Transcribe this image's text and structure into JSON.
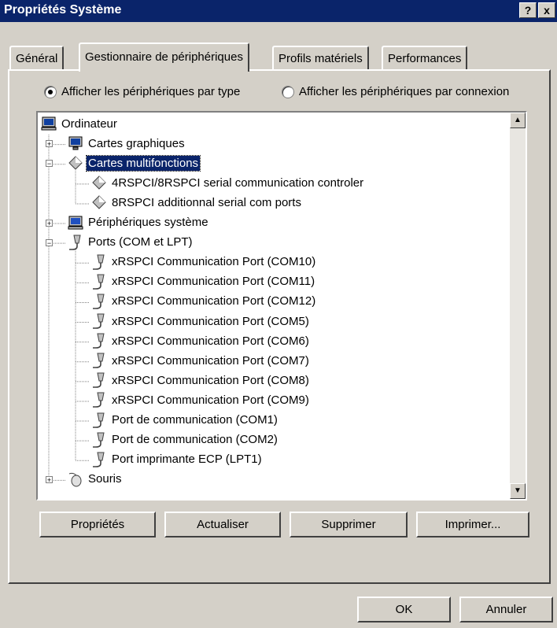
{
  "window": {
    "title": "Propriétés Système",
    "help_label": "?",
    "close_label": "x"
  },
  "tabs": [
    {
      "label": "Général"
    },
    {
      "label": "Gestionnaire de périphériques"
    },
    {
      "label": "Profils matériels"
    },
    {
      "label": "Performances"
    }
  ],
  "view_options": {
    "by_type": {
      "label": "Afficher les périphériques par type",
      "selected": true
    },
    "by_connection": {
      "label": "Afficher les périphériques par connexion",
      "selected": false
    }
  },
  "tree": {
    "root": "Ordinateur",
    "items": [
      {
        "label": "Cartes graphiques",
        "icon": "display-adapter-icon",
        "level": 1,
        "expander": "+"
      },
      {
        "label": "Cartes multifonctions",
        "icon": "multifunction-card-icon",
        "level": 1,
        "expander": "-",
        "selected": true
      },
      {
        "label": "4RSPCI/8RSPCI serial communication controler",
        "icon": "multifunction-card-icon",
        "level": 2
      },
      {
        "label": "8RSPCI additionnal serial com ports",
        "icon": "multifunction-card-icon",
        "level": 2
      },
      {
        "label": "Périphériques système",
        "icon": "system-devices-icon",
        "level": 1,
        "expander": "+"
      },
      {
        "label": "Ports (COM et LPT)",
        "icon": "port-connector-icon",
        "level": 1,
        "expander": "-"
      },
      {
        "label": "xRSPCI Communication Port (COM10)",
        "icon": "port-connector-icon",
        "level": 2
      },
      {
        "label": "xRSPCI Communication Port (COM11)",
        "icon": "port-connector-icon",
        "level": 2
      },
      {
        "label": "xRSPCI Communication Port (COM12)",
        "icon": "port-connector-icon",
        "level": 2
      },
      {
        "label": "xRSPCI Communication Port (COM5)",
        "icon": "port-connector-icon",
        "level": 2
      },
      {
        "label": "xRSPCI Communication Port (COM6)",
        "icon": "port-connector-icon",
        "level": 2
      },
      {
        "label": "xRSPCI Communication Port (COM7)",
        "icon": "port-connector-icon",
        "level": 2
      },
      {
        "label": "xRSPCI Communication Port (COM8)",
        "icon": "port-connector-icon",
        "level": 2
      },
      {
        "label": "xRSPCI Communication Port (COM9)",
        "icon": "port-connector-icon",
        "level": 2
      },
      {
        "label": "Port de communication (COM1)",
        "icon": "port-connector-icon",
        "level": 2
      },
      {
        "label": "Port de communication (COM2)",
        "icon": "port-connector-icon",
        "level": 2
      },
      {
        "label": "Port imprimante ECP (LPT1)",
        "icon": "port-connector-icon",
        "level": 2
      },
      {
        "label": "Souris",
        "icon": "mouse-icon",
        "level": 1,
        "expander": "+"
      }
    ]
  },
  "buttons": {
    "properties": "Propriétés",
    "refresh": "Actualiser",
    "remove": "Supprimer",
    "print": "Imprimer...",
    "ok": "OK",
    "cancel": "Annuler"
  },
  "colors": {
    "titlebar": "#0a246a",
    "face": "#d4d0c8",
    "selection": "#0a246a"
  }
}
